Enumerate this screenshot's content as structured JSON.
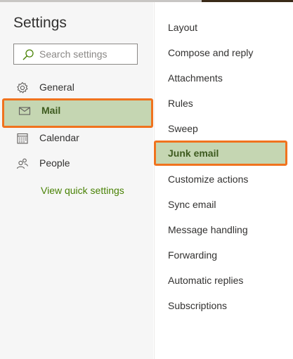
{
  "settings": {
    "title": "Settings",
    "search_placeholder": "Search settings"
  },
  "nav": {
    "items": [
      {
        "label": "General",
        "icon": "gear-icon"
      },
      {
        "label": "Mail",
        "icon": "mail-icon",
        "selected": true
      },
      {
        "label": "Calendar",
        "icon": "calendar-icon"
      },
      {
        "label": "People",
        "icon": "people-icon"
      }
    ],
    "quick_settings_link": "View quick settings"
  },
  "mail_settings": {
    "items": [
      {
        "label": "Layout"
      },
      {
        "label": "Compose and reply"
      },
      {
        "label": "Attachments"
      },
      {
        "label": "Rules"
      },
      {
        "label": "Sweep"
      },
      {
        "label": "Junk email",
        "selected": true
      },
      {
        "label": "Customize actions"
      },
      {
        "label": "Sync email"
      },
      {
        "label": "Message handling"
      },
      {
        "label": "Forwarding"
      },
      {
        "label": "Automatic replies"
      },
      {
        "label": "Subscriptions"
      }
    ]
  },
  "colors": {
    "highlight": "#c5d6b2",
    "highlight_border": "#f0731e",
    "link": "#498205"
  }
}
